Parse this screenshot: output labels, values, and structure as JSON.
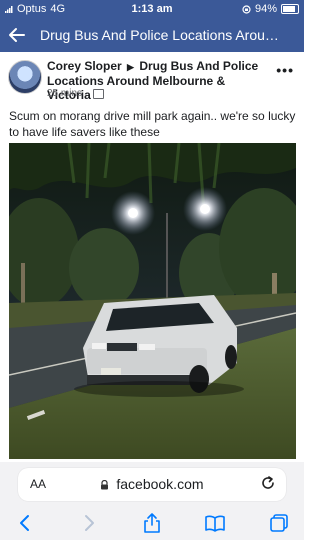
{
  "status_bar": {
    "carrier": "Optus",
    "network": "4G",
    "time": "1:13 am",
    "battery": "94%"
  },
  "nav": {
    "title": "Drug Bus And Police Locations Arou…"
  },
  "post": {
    "author": "Corey Sloper",
    "group": "Drug Bus And Police Locations Around Melbourne & Victoria",
    "time": "25 mins",
    "text": "Scum on morang drive mill park again.. we're so lucky to have life savers like these"
  },
  "browser": {
    "text_size_label": "AA",
    "domain": "facebook.com"
  },
  "colors": {
    "brand": "#3b5998",
    "ios_blue": "#007aff"
  }
}
